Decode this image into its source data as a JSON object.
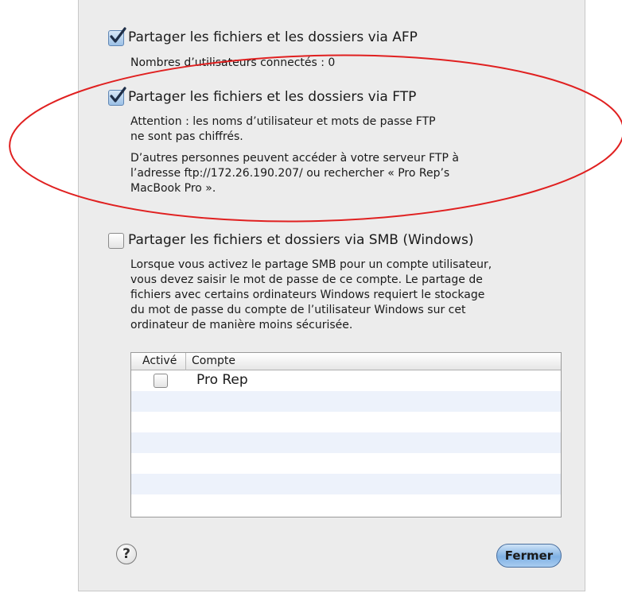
{
  "afp": {
    "label": "Partager les fichiers et les dossiers via AFP",
    "checked": true,
    "users_connected": "Nombres d’utilisateurs connectés :  0"
  },
  "ftp": {
    "label": "Partager les fichiers et les dossiers via FTP",
    "checked": true,
    "warning_line1": "Attention : les noms d’utilisateur et mots de passe FTP",
    "warning_line2": "ne sont pas chiffrés.",
    "access_line1": "D’autres personnes peuvent accéder à votre serveur FTP à",
    "access_line2": "l’adresse ftp://172.26.190.207/ ou rechercher « Pro Rep’s",
    "access_line3": "MacBook Pro »."
  },
  "smb": {
    "label": "Partager les fichiers et dossiers via SMB (Windows)",
    "checked": false,
    "desc_line1": "Lorsque vous activez le partage SMB pour un compte utilisateur,",
    "desc_line2": "vous devez saisir le mot de passe de ce compte. Le partage de",
    "desc_line3": "fichiers avec certains ordinateurs Windows requiert le stockage",
    "desc_line4": "du mot de passe du compte de l’utilisateur Windows sur cet",
    "desc_line5": "ordinateur de manière moins sécurisée."
  },
  "accounts_table": {
    "col_enabled": "Activé",
    "col_account": "Compte",
    "rows": [
      {
        "enabled": false,
        "account": "Pro Rep"
      }
    ]
  },
  "footer": {
    "help_label": "?",
    "close_label": "Fermer"
  },
  "annotation_color": "#e02020",
  "accent_color": "#7fb0e3"
}
